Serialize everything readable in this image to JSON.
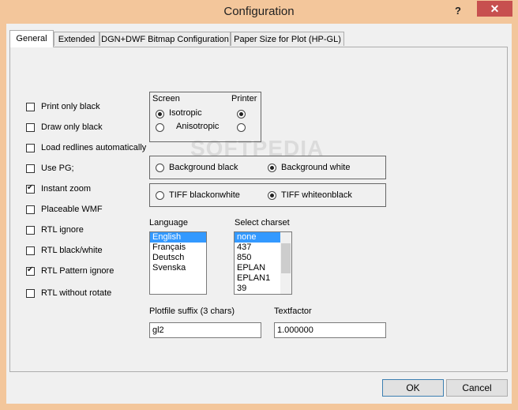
{
  "window": {
    "title": "Configuration",
    "help_label": "?",
    "close_label": "✕"
  },
  "tabs": [
    {
      "label": "General"
    },
    {
      "label": "Extended"
    },
    {
      "label": "DGN+DWF Bitmap Configuration"
    },
    {
      "label": "Paper Size for Plot (HP-GL)"
    }
  ],
  "checkboxes": [
    {
      "label": "Print only black",
      "checked": false
    },
    {
      "label": "Draw only black",
      "checked": false
    },
    {
      "label": "Load redlines automatically",
      "checked": false
    },
    {
      "label": "Use PG;",
      "checked": false
    },
    {
      "label": "Instant zoom",
      "checked": true
    },
    {
      "label": "Placeable WMF",
      "checked": false
    },
    {
      "label": "RTL ignore",
      "checked": false
    },
    {
      "label": "RTL black/white",
      "checked": false
    },
    {
      "label": "RTL Pattern ignore",
      "checked": true
    },
    {
      "label": "RTL without rotate",
      "checked": false
    }
  ],
  "projection": {
    "screen_label": "Screen",
    "printer_label": "Printer",
    "isotropic_label": "Isotropic",
    "anisotropic_label": "Anisotropic"
  },
  "background": {
    "black_label": "Background black",
    "white_label": "Background white",
    "selected": "white"
  },
  "tiff": {
    "blackonwhite_label": "TIFF blackonwhite",
    "whiteonblack_label": "TIFF whiteonblack",
    "selected": "whiteonblack"
  },
  "language": {
    "label": "Language",
    "items": [
      "English",
      "Français",
      "Deutsch",
      "Svenska"
    ],
    "selected_index": 0
  },
  "charset": {
    "label": "Select charset",
    "items": [
      "none",
      "437",
      "850",
      "EPLAN",
      "EPLAN1",
      "39"
    ],
    "selected_index": 0
  },
  "plotfile": {
    "label": "Plotfile suffix (3 chars)",
    "value": "gl2"
  },
  "textfactor": {
    "label": "Textfactor",
    "value": "1.000000"
  },
  "buttons": {
    "ok_label": "OK",
    "cancel_label": "Cancel"
  },
  "watermark": "SOFTPEDIA",
  "colors": {
    "titlebar": "#f3c69b",
    "close_button": "#c7504f",
    "selection": "#3399ff"
  }
}
